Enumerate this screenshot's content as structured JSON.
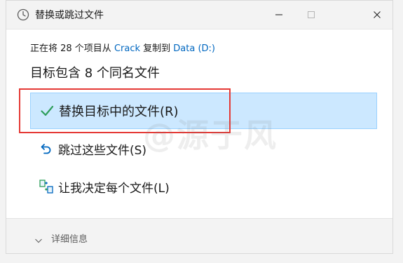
{
  "window": {
    "title": "替换或跳过文件",
    "icon": "clock-icon",
    "controls": [
      "minimize-icon",
      "maximize-icon",
      "close-icon"
    ]
  },
  "status": {
    "prefix": "正在将 28 个项目从 ",
    "source": "Crack",
    "middle": " 复制到 ",
    "destination": "Data (D:)"
  },
  "heading": "目标包含 8 个同名文件",
  "options": [
    {
      "label": "替换目标中的文件(R)",
      "icon": "checkmark-icon",
      "selected": true
    },
    {
      "label": "跳过这些文件(S)",
      "icon": "skip-arrow-icon",
      "selected": false
    },
    {
      "label": "让我决定每个文件(L)",
      "icon": "compare-files-icon",
      "selected": false
    }
  ],
  "details_label": "详细信息",
  "watermark": "@源于风",
  "colors": {
    "accent": "#0067c0",
    "selected_bg": "#cce8ff",
    "annotation_red": "#e53935",
    "check_green": "#2e9e5b"
  }
}
